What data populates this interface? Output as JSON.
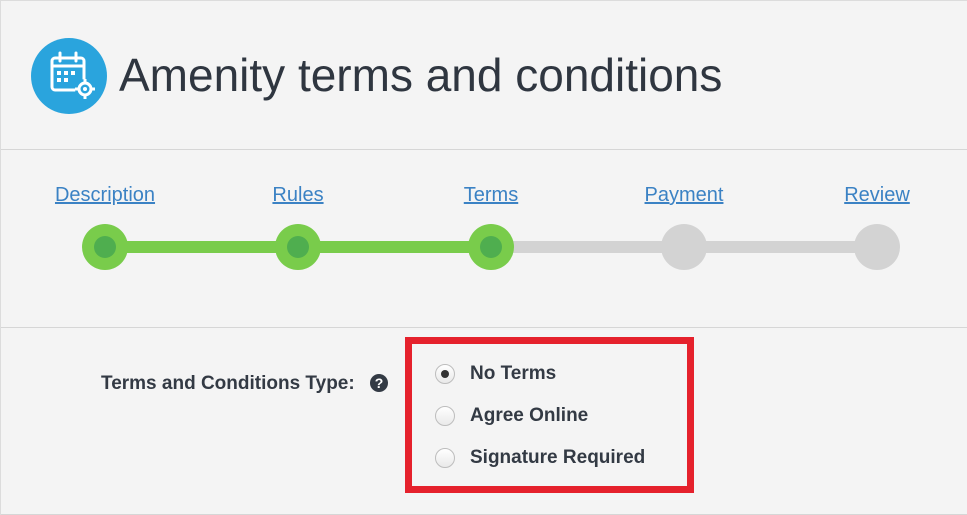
{
  "header": {
    "title": "Amenity terms and conditions",
    "icon": "calendar-gear-icon",
    "icon_color": "#2aa4dd"
  },
  "stepper": {
    "completed_through": 3,
    "active_color": "#79cc4b",
    "inactive_color": "#d3d3d3",
    "steps": [
      {
        "label": "Description",
        "state": "done"
      },
      {
        "label": "Rules",
        "state": "done"
      },
      {
        "label": "Terms",
        "state": "current"
      },
      {
        "label": "Payment",
        "state": "pending"
      },
      {
        "label": "Review",
        "state": "pending"
      }
    ]
  },
  "form": {
    "terms_type_label": "Terms and Conditions Type:",
    "help_icon": "question-circle-icon",
    "highlight_color": "#e5212c",
    "options": [
      {
        "label": "No Terms",
        "checked": true
      },
      {
        "label": "Agree Online",
        "checked": false
      },
      {
        "label": "Signature Required",
        "checked": false
      }
    ]
  }
}
